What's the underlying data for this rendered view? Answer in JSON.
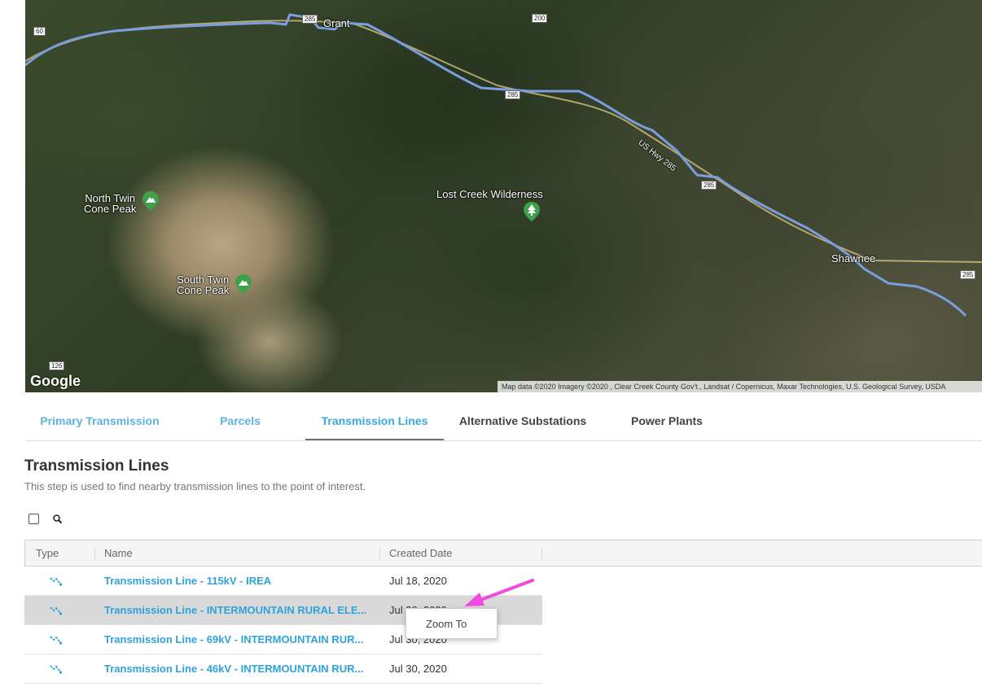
{
  "map": {
    "labels": {
      "north_twin": "North Twin\nCone Peak",
      "south_twin": "South Twin\nCone Peak",
      "lost_creek": "Lost Creek Wilderness",
      "shawnee": "Shawnee",
      "grant": "Grant",
      "hwy_label": "US Hwy 285"
    },
    "shields": {
      "s60": "60",
      "s285a": "285",
      "s200": "200",
      "s285b": "285",
      "s285c": "285",
      "s285d": "285",
      "s126": "126"
    },
    "google_logo": "Google",
    "attribution": "Map data ©2020 Imagery ©2020 , Clear Creek County Gov't., Landsat / Copernicus, Maxar Technologies, U.S. Geological Survey, USDA",
    "route_color": "#7b9ee0",
    "pin_color": "#3ea14a"
  },
  "tabs": [
    {
      "label": "Primary Transmission",
      "state": "link"
    },
    {
      "label": "Parcels",
      "state": "link"
    },
    {
      "label": "Transmission Lines",
      "state": "active"
    },
    {
      "label": "Alternative Substations",
      "state": "plain"
    },
    {
      "label": "Power Plants",
      "state": "plain"
    }
  ],
  "section": {
    "title": "Transmission Lines",
    "description": "This step is used to find nearby transmission lines to the point of interest."
  },
  "toolbar": {
    "search_icon": "search-icon",
    "select_all_icon": "checkbox-icon"
  },
  "grid": {
    "columns": [
      "Type",
      "Name",
      "Created Date"
    ],
    "rows": [
      {
        "type_icon": "transmission-line-icon",
        "name": "Transmission Line - 115kV - IREA",
        "date": "Jul 18, 2020",
        "selected": false
      },
      {
        "type_icon": "transmission-line-icon",
        "name": "Transmission Line - INTERMOUNTAIN RURAL ELE...",
        "date": "Jul 30, 2020",
        "selected": true
      },
      {
        "type_icon": "transmission-line-icon",
        "name": "Transmission Line - 69kV - INTERMOUNTAIN RUR...",
        "date": "Jul 30, 2020",
        "selected": false
      },
      {
        "type_icon": "transmission-line-icon",
        "name": "Transmission Line - 46kV - INTERMOUNTAIN RUR...",
        "date": "Jul 30, 2020",
        "selected": false
      }
    ]
  },
  "context_menu": {
    "items": [
      "Zoom To"
    ]
  },
  "colors": {
    "accent": "#3aa7dd",
    "annotation_arrow": "#f04be0",
    "selected_row": "#d9d9d9"
  }
}
